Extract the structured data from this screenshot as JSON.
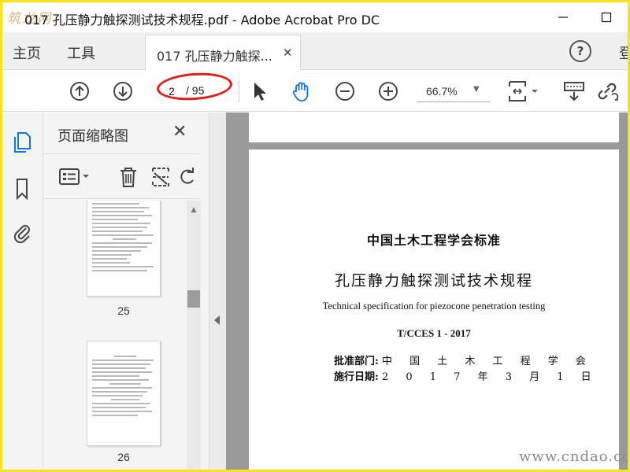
{
  "window": {
    "title": "017 孔压静力触探测试技术规程.pdf - Adobe Acrobat Pro DC",
    "logo_text": "筑龙网",
    "minimize_icon": "minimize-icon",
    "maximize_icon": "maximize-icon"
  },
  "tabbar": {
    "home": "主页",
    "tools": "工具",
    "doc_tab": "017 孔压静力触探...",
    "help": "?",
    "login_cut": "登"
  },
  "toolbar": {
    "current_page": "2",
    "total_pages": "/ 95",
    "zoom": "66.7%",
    "icons": [
      "arrow-up-circle-icon",
      "arrow-down-circle-icon",
      "pointer-icon",
      "hand-icon",
      "zoom-out-icon",
      "zoom-in-icon",
      "page-fit-icon",
      "scroll-mode-icon",
      "link-icon"
    ],
    "annotation_color": "#e21b1b"
  },
  "rail": {
    "icons": [
      "pages-icon",
      "bookmark-icon",
      "attachment-icon"
    ],
    "active_color": "#1473e6"
  },
  "thumbnails_panel": {
    "title": "页面缩略图",
    "close": "✕",
    "tools": [
      "options-icon",
      "delete-icon",
      "crop-icon",
      "rotate-icon"
    ],
    "pages": [
      {
        "label": "25"
      },
      {
        "label": "26"
      }
    ]
  },
  "document": {
    "standard_org": "中国土木工程学会标准",
    "title_zh": "孔压静力触探测试技术规程",
    "title_en": "Technical specification for piezocone penetration testing",
    "code": "T/CCES 1 - 2017",
    "approval_label": "批准部门:",
    "approval_value": "中 国 土 木 工 程 学 会",
    "effective_label": "施行日期:",
    "effective_value": "2 0 1 7 年 3 月 1 日"
  },
  "watermark": "www.cndao.com"
}
